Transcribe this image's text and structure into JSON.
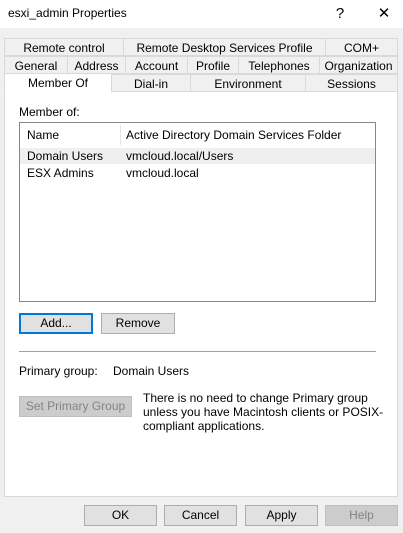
{
  "window": {
    "title": "esxi_admin Properties",
    "help_glyph": "?",
    "close_glyph": "✕"
  },
  "tabs_row1": [
    "Remote control",
    "Remote Desktop Services Profile",
    "COM+"
  ],
  "tabs_row2": [
    "General",
    "Address",
    "Account",
    "Profile",
    "Telephones",
    "Organization"
  ],
  "tabs_row3": [
    "Member Of",
    "Dial-in",
    "Environment",
    "Sessions"
  ],
  "member_of": {
    "label": "Member of:",
    "columns": [
      "Name",
      "Active Directory Domain Services Folder"
    ],
    "rows": [
      {
        "name": "Domain Users",
        "folder": "vmcloud.local/Users"
      },
      {
        "name": "ESX Admins",
        "folder": "vmcloud.local"
      }
    ],
    "add_label": "Add...",
    "remove_label": "Remove"
  },
  "primary": {
    "label": "Primary group:",
    "value": "Domain Users",
    "set_button": "Set Primary Group",
    "note": "There is no need to change Primary group unless you have Macintosh clients or POSIX-compliant applications."
  },
  "footer": {
    "ok": "OK",
    "cancel": "Cancel",
    "apply": "Apply",
    "help": "Help"
  }
}
